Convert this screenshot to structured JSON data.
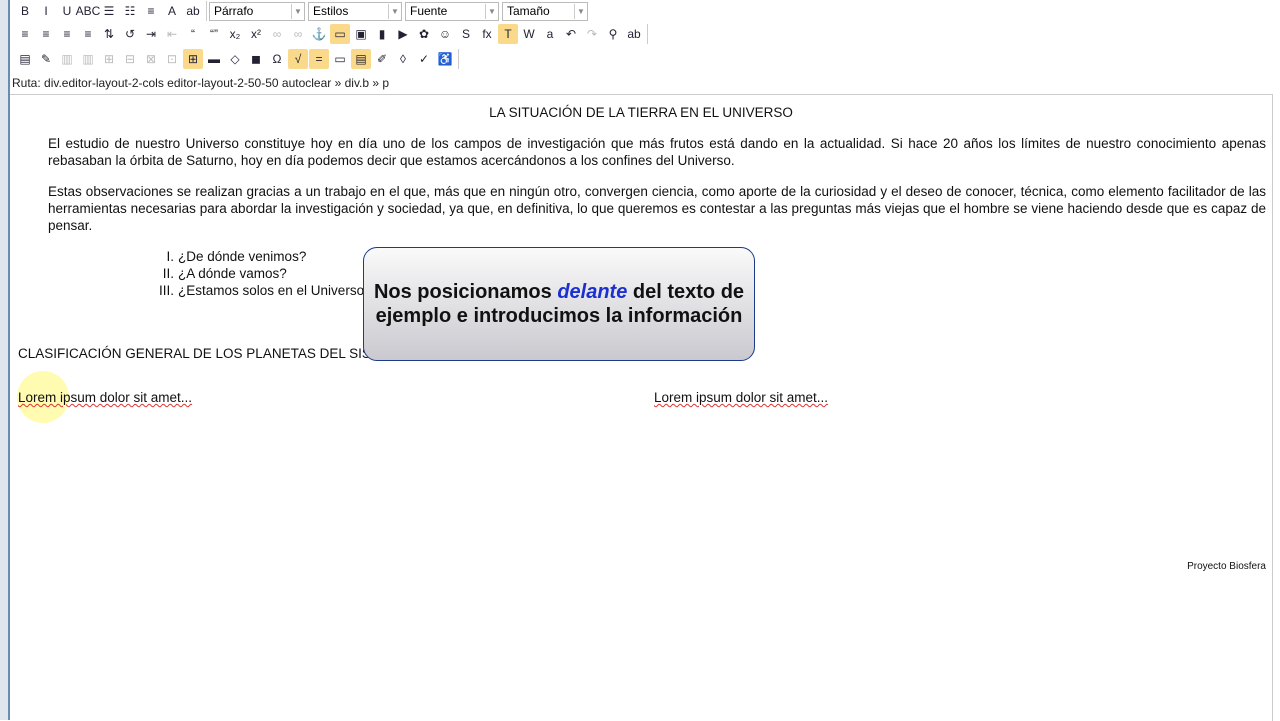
{
  "toolbar": {
    "row1": [
      {
        "name": "bold-icon",
        "g": "B"
      },
      {
        "name": "italic-icon",
        "g": "I"
      },
      {
        "name": "underline-icon",
        "g": "U"
      },
      {
        "name": "strikethrough-icon",
        "g": "ABC"
      },
      {
        "name": "bulleted-list-icon",
        "g": "☰"
      },
      {
        "name": "numbered-list-icon",
        "g": "☷"
      },
      {
        "name": "align-icon",
        "g": "≡"
      },
      {
        "name": "text-color-icon",
        "g": "A"
      },
      {
        "name": "highlight-color-icon",
        "g": "ab"
      }
    ],
    "selects": [
      {
        "label": "Párrafo"
      },
      {
        "label": "Estilos"
      },
      {
        "label": "Fuente"
      },
      {
        "label": "Tamaño"
      }
    ],
    "row2": [
      {
        "name": "align-left-icon",
        "g": "≡"
      },
      {
        "name": "align-center-icon",
        "g": "≡"
      },
      {
        "name": "align-right-icon",
        "g": "≡"
      },
      {
        "name": "justify-icon",
        "g": "≡"
      },
      {
        "name": "ltr-icon",
        "g": "⇅"
      },
      {
        "name": "rtl-icon",
        "g": "↺"
      },
      {
        "name": "indent-icon",
        "g": "⇥"
      },
      {
        "name": "outdent-icon",
        "g": "⇤"
      },
      {
        "name": "blockquote-icon",
        "g": "“"
      },
      {
        "name": "cite-icon",
        "g": "“”"
      },
      {
        "name": "subscript-icon",
        "g": "x₂"
      },
      {
        "name": "superscript-icon",
        "g": "x²"
      },
      {
        "name": "link-icon",
        "g": "∞"
      },
      {
        "name": "unlink-icon",
        "g": "∞"
      },
      {
        "name": "anchor-icon",
        "g": "⚓"
      },
      {
        "name": "note-icon",
        "g": "▭"
      },
      {
        "name": "image-icon",
        "g": "▣"
      },
      {
        "name": "video-icon",
        "g": "▮"
      },
      {
        "name": "youtube-icon",
        "g": "▶"
      },
      {
        "name": "picasa-icon",
        "g": "✿"
      },
      {
        "name": "people-icon",
        "g": "☺"
      },
      {
        "name": "scribd-icon",
        "g": "S"
      },
      {
        "name": "formula-icon",
        "g": "fx"
      },
      {
        "name": "paste-text-icon",
        "g": "T"
      },
      {
        "name": "paste-word-icon",
        "g": "W"
      },
      {
        "name": "select-all-icon",
        "g": "a"
      },
      {
        "name": "undo-icon",
        "g": "↶"
      },
      {
        "name": "redo-icon",
        "g": "↷"
      },
      {
        "name": "find-icon",
        "g": "⚲"
      },
      {
        "name": "replace-icon",
        "g": "ab"
      }
    ],
    "row3": [
      {
        "name": "template-icon",
        "g": "▤"
      },
      {
        "name": "form-icon",
        "g": "✎"
      },
      {
        "name": "table-row-icon",
        "g": "▥"
      },
      {
        "name": "table-col-icon",
        "g": "▥"
      },
      {
        "name": "cell-icon",
        "g": "⊞"
      },
      {
        "name": "cell-merge-icon",
        "g": "⊟"
      },
      {
        "name": "cell-split-icon",
        "g": "⊠"
      },
      {
        "name": "table-props-icon",
        "g": "⊡"
      },
      {
        "name": "table-icon",
        "g": "⊞"
      },
      {
        "name": "horizontal-rule-icon",
        "g": "▬"
      },
      {
        "name": "code-icon",
        "g": "◇"
      },
      {
        "name": "embed-icon",
        "g": "◼"
      },
      {
        "name": "special-char-icon",
        "g": "Ω"
      },
      {
        "name": "math-icon",
        "g": "√"
      },
      {
        "name": "equals-icon",
        "g": "="
      },
      {
        "name": "html-icon",
        "g": "▭"
      },
      {
        "name": "source-icon",
        "g": "▤"
      },
      {
        "name": "clean-icon",
        "g": "✐"
      },
      {
        "name": "eraser-icon",
        "g": "◊"
      },
      {
        "name": "spellcheck-icon",
        "g": "✓"
      },
      {
        "name": "accessibility-icon",
        "g": "♿"
      }
    ]
  },
  "path": "Ruta: div.editor-layout-2-cols editor-layout-2-50-50 autoclear » div.b » p",
  "content": {
    "title": "LA SITUACIÓN DE LA TIERRA EN EL UNIVERSO",
    "p1": "El estudio de nuestro Universo constituye hoy en día uno de los campos de investigación que más frutos está dando en la actualidad. Si hace 20 años los límites de nuestro conocimiento apenas rebasaban la órbita de Saturno, hoy en día podemos decir que estamos acercándonos a los confines del Universo.",
    "p2": "Estas observaciones se realizan gracias a un trabajo en el que, más que en ningún otro, convergen ciencia, como aporte de la curiosidad y el deseo de conocer, técnica, como elemento facilitador de las herramientas necesarias para abordar la investigación y sociedad, ya que, en definitiva, lo que queremos es contestar a las preguntas más viejas que el hombre se viene haciendo desde que es capaz de pensar.",
    "list": [
      {
        "n": "I.",
        "t": "¿De dónde venimos?"
      },
      {
        "n": "II.",
        "t": "¿A dónde vamos?"
      },
      {
        "n": "III.",
        "t": "¿Estamos solos en el Universo?"
      }
    ],
    "heading2": "CLASIFICACIÓN GENERAL DE LOS PLANETAS DEL SISTEMA SOLAR",
    "col1": "Lorem ipsum dolor sit amet...",
    "col2": "Lorem ipsum dolor sit amet...",
    "footer": "Proyecto Biosfera"
  },
  "callout": {
    "before": "Nos posicionamos ",
    "em": "delante",
    "after": " del texto de ejemplo e introducimos la información"
  }
}
